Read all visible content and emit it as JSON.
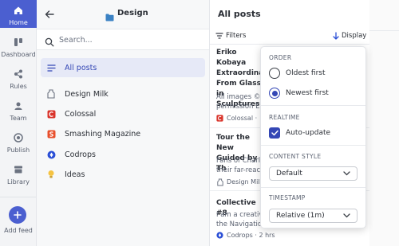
{
  "rail": {
    "items": [
      {
        "label": "Home",
        "icon": "home-icon"
      },
      {
        "label": "Dashboard",
        "icon": "dashboard-icon"
      },
      {
        "label": "Rules",
        "icon": "rules-icon"
      },
      {
        "label": "Team",
        "icon": "team-icon"
      },
      {
        "label": "Publish",
        "icon": "publish-icon"
      },
      {
        "label": "Library",
        "icon": "library-icon"
      }
    ],
    "add_label": "Add feed"
  },
  "folder": {
    "title": "Design",
    "search_placeholder": "Search...",
    "items": [
      {
        "label": "All posts",
        "icon": "list-icon"
      },
      {
        "label": "Design Milk",
        "icon": "milk-icon"
      },
      {
        "label": "Colossal",
        "icon": "colossal-icon"
      },
      {
        "label": "Smashing Magazine",
        "icon": "smashing-icon"
      },
      {
        "label": "Codrops",
        "icon": "codrops-icon"
      },
      {
        "label": "Ideas",
        "icon": "bulb-icon"
      }
    ]
  },
  "posts": {
    "title": "All posts",
    "filters_label": "Filters",
    "display_label": "Display",
    "items": [
      {
        "title_lines": [
          "Eriko Kobaya",
          "Extraordinari",
          "From Glass in",
          "Sculptures"
        ],
        "excerpt_lines": [
          "All images © E",
          "permission Er"
        ],
        "source": "Colossal · "
      },
      {
        "title_lines": [
          "Tour the New",
          "Guided by Th"
        ],
        "excerpt_lines": [
          "Fans of Charle",
          "their far-reach"
        ],
        "source": "Design Mil"
      },
      {
        "title_lines": [
          "Collective #8"
        ],
        "excerpt_lines": [
          "I am a creativ",
          "the Navigation"
        ],
        "source": "Codrops · 2 hrs"
      }
    ]
  },
  "display_menu": {
    "order_heading": "ORDER",
    "oldest_label": "Oldest first",
    "newest_label": "Newest first",
    "selected_order": "Newest first",
    "realtime_heading": "REALTIME",
    "autoupdate_label": "Auto-update",
    "autoupdate_checked": true,
    "content_style_heading": "CONTENT STYLE",
    "content_style_value": "Default",
    "timestamp_heading": "TIMESTAMP",
    "timestamp_value": "Relative (1m)"
  },
  "colors": {
    "accent": "#4b5fd0",
    "selected": "#3447b5"
  }
}
